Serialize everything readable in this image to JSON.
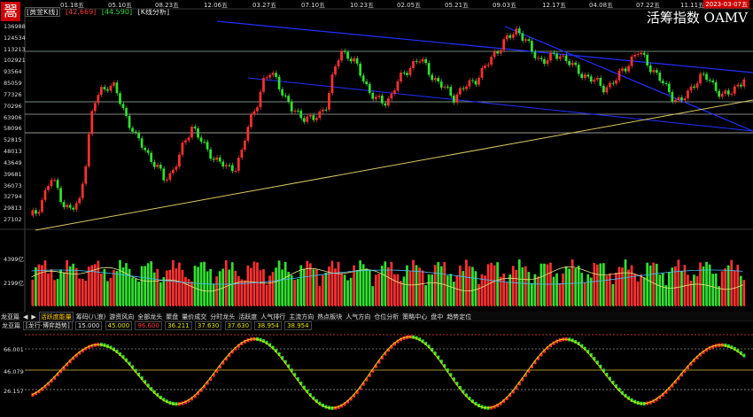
{
  "app": {
    "logo_char": "翯",
    "stock_name": "[黄金K线]",
    "val_red": "[42.669]",
    "val_green": "[44.590]",
    "kline_label": "[K线分析]",
    "title": "活筹指数 OAMV",
    "date_badge": "2023-03-07五"
  },
  "dates": [
    "01.18五",
    "05.10五",
    "08.23五",
    "12.06五",
    "03.27五",
    "07.10五",
    "10.23五",
    "02.05五",
    "05.21五",
    "09.03五",
    "12.17五",
    "04.08五",
    "07.22五",
    "11.11五"
  ],
  "y_labels": [
    "136988",
    "124534",
    "113213",
    "102921",
    "93564",
    "85059",
    "77326",
    "70296",
    "63906",
    "58096",
    "52815",
    "48013",
    "43649",
    "39681",
    "36073",
    "32794",
    "29813",
    "27102"
  ],
  "vol_labels": [
    "4399亿",
    "2199亿"
  ],
  "ind_labels": [
    "66.001",
    "46.079",
    "26.157"
  ],
  "tabs": [
    "龙亚篇",
    "◀",
    "▶",
    "活跃度能量",
    "筹码(八浪)",
    "游资风向",
    "全部龙头",
    "聚盘",
    "量价成交",
    "分时龙头",
    "活跃度",
    "人气排行",
    "主流方向",
    "热点板块",
    "人气方向",
    "仓位分析",
    "策略中心",
    "盘中",
    "趋势定位"
  ],
  "indicator": {
    "name": "龙亚篇",
    "sub": "[龙行·博弈趋势]",
    "values": [
      "15.000",
      "45.000",
      "96.600",
      "36.211",
      "37.630",
      "37.630",
      "38.954",
      "38.954"
    ]
  },
  "colors": {
    "up": "#ff3030",
    "down": "#30e030",
    "bg": "#000000",
    "trend_blue": "#2030ff",
    "trend_yellow": "#d8c860",
    "hline": "#cfcf88"
  },
  "chart_data": {
    "type": "candlestick",
    "x_labels": [
      "01.18五",
      "05.10五",
      "08.23五",
      "12.06五",
      "03.27五",
      "07.10五",
      "10.23五",
      "02.05五",
      "05.21五",
      "09.03五",
      "12.17五",
      "04.08五",
      "07.22五",
      "11.11五"
    ],
    "y_ticks": [
      136988,
      124534,
      113213,
      102921,
      93564,
      85059,
      77326,
      70296,
      63906,
      58096,
      52815,
      48013,
      43649,
      39681,
      36073,
      32794,
      29813,
      27102
    ],
    "price_path": [
      27500,
      29000,
      33000,
      38000,
      35000,
      30000,
      29500,
      31000,
      45000,
      70000,
      80000,
      84000,
      82000,
      70000,
      62000,
      54000,
      50000,
      46000,
      42000,
      38000,
      40000,
      45000,
      52000,
      60000,
      54000,
      48000,
      46000,
      44000,
      41000,
      42000,
      48000,
      60000,
      70000,
      86000,
      92000,
      88000,
      76000,
      68000,
      66000,
      64000,
      62000,
      66000,
      72000,
      92000,
      112000,
      108000,
      100000,
      90000,
      80000,
      74000,
      72000,
      76000,
      86000,
      92000,
      100000,
      104000,
      98000,
      90000,
      84000,
      80000,
      76000,
      80000,
      84000,
      88000,
      94000,
      102000,
      112000,
      120000,
      126000,
      134000,
      124000,
      110000,
      104000,
      104000,
      106000,
      108000,
      104000,
      96000,
      92000,
      90000,
      86000,
      82000,
      84000,
      88000,
      96000,
      104000,
      110000,
      104000,
      96000,
      88000,
      82000,
      76000,
      72000,
      78000,
      86000,
      90000,
      88000,
      82000,
      76000,
      78000,
      84000,
      88000
    ]
  }
}
